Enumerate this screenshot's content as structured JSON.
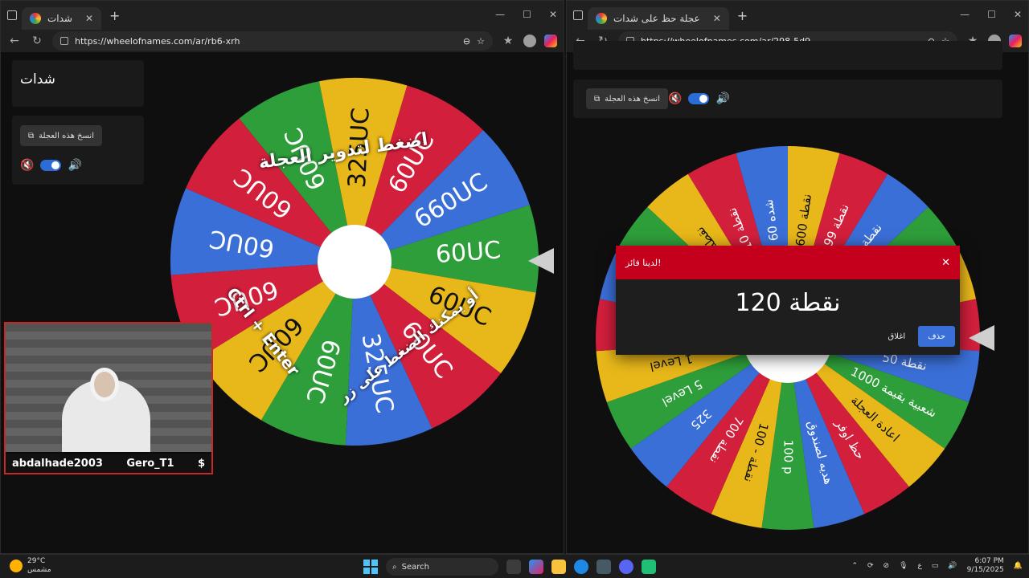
{
  "left_window": {
    "tab_title": "شدات",
    "url": "https://wheelofnames.com/ar/rb6-xrh",
    "title_card": "شدات",
    "duplicate_button": "انسخ هذه العجلة",
    "wheel": {
      "center_text_lines": [
        "اضغط لتدوير العجلة",
        "أو يمكنك الضغط على زر",
        "Ctrl + Enter"
      ],
      "segments": [
        {
          "label": "60UC",
          "color": "#2e9e3a"
        },
        {
          "label": "60UC",
          "color": "#e8b71a"
        },
        {
          "label": "60UC",
          "color": "#d21f3c"
        },
        {
          "label": "325UC",
          "color": "#3b6fd8"
        },
        {
          "label": "60UC",
          "color": "#2e9e3a"
        },
        {
          "label": "60UC",
          "color": "#e8b71a"
        },
        {
          "label": "60UC",
          "color": "#d21f3c"
        },
        {
          "label": "60UC",
          "color": "#3b6fd8"
        },
        {
          "label": "60UC",
          "color": "#d21f3c"
        },
        {
          "label": "60UC",
          "color": "#2e9e3a"
        },
        {
          "label": "325UC",
          "color": "#e8b71a"
        },
        {
          "label": "60UC",
          "color": "#d21f3c"
        },
        {
          "label": "660UC",
          "color": "#3b6fd8"
        }
      ]
    }
  },
  "right_window": {
    "tab_title": "عجلة حظ على شدات",
    "url": "https://wheelofnames.com/ar/298-5d9",
    "duplicate_button": "انسخ هذه العجلة",
    "wheel": {
      "segments": [
        {
          "label": "نقطة 600",
          "color": "#e8b71a"
        },
        {
          "label": "نقطة 499",
          "color": "#d21f3c"
        },
        {
          "label": "نقطة 170",
          "color": "#3b6fd8"
        },
        {
          "label": "نقطة",
          "color": "#2e9e3a"
        },
        {
          "label": "نقطة",
          "color": "#e8b71a"
        },
        {
          "label": "نقطة 120",
          "color": "#d21f3c"
        },
        {
          "label": "نقطة 50",
          "color": "#3b6fd8"
        },
        {
          "label": "شعبية بقيمة 1000",
          "color": "#2e9e3a"
        },
        {
          "label": "اعادة العجلة",
          "color": "#e8b71a"
        },
        {
          "label": "حظ اوفر",
          "color": "#d21f3c"
        },
        {
          "label": "هديه لصندوق",
          "color": "#3b6fd8"
        },
        {
          "label": "100 p",
          "color": "#2e9e3a"
        },
        {
          "label": "100 - نقطة",
          "color": "#e8b71a"
        },
        {
          "label": "700 نقطة",
          "color": "#d21f3c"
        },
        {
          "label": "325",
          "color": "#3b6fd8"
        },
        {
          "label": "5 Level",
          "color": "#2e9e3a"
        },
        {
          "label": "1 Level",
          "color": "#e8b71a"
        },
        {
          "label": "نقطة",
          "color": "#d21f3c"
        },
        {
          "label": "نقطة",
          "color": "#3b6fd8"
        },
        {
          "label": "نقطة",
          "color": "#2e9e3a"
        },
        {
          "label": "20 نقطة",
          "color": "#e8b71a"
        },
        {
          "label": "10 نقطة",
          "color": "#d21f3c"
        },
        {
          "label": "شده 60",
          "color": "#3b6fd8"
        }
      ]
    },
    "dialog": {
      "title": "لدينا فائز!",
      "winner": "نقطة 120",
      "close_label": "اغلاق",
      "remove_label": "حذف"
    }
  },
  "webcam": {
    "username_left": "abdalhade2003",
    "username_right": "Gero_T1",
    "currency_symbol": "$"
  },
  "taskbar": {
    "weather_temp": "29°C",
    "weather_desc": "مشمس",
    "search_label": "Search",
    "lang": "ع",
    "time": "6:07 PM",
    "date": "9/15/2025"
  }
}
